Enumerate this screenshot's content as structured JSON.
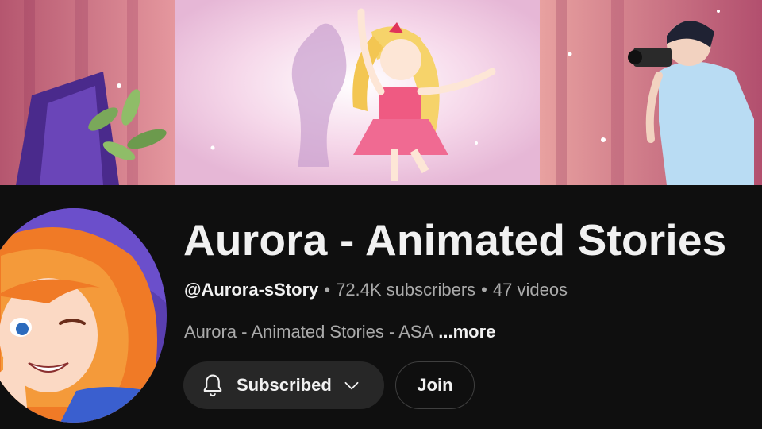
{
  "channel": {
    "title": "Aurora - Animated Stories",
    "handle": "@Aurora-sStory",
    "subscribers": "72.4K subscribers",
    "videos": "47 videos",
    "separator": "•",
    "description": "Aurora - Animated Stories - ASA",
    "more_label": "...more"
  },
  "buttons": {
    "subscribed_label": "Subscribed",
    "join_label": "Join"
  },
  "icons": {
    "subscribe_bell": "bell-icon",
    "subscribe_menu": "chevron-down-icon"
  },
  "colors": {
    "background": "#0f0f0f",
    "primary_text": "#f1f1f1",
    "secondary_text": "#aaaaaa",
    "button_bg": "#272727"
  }
}
